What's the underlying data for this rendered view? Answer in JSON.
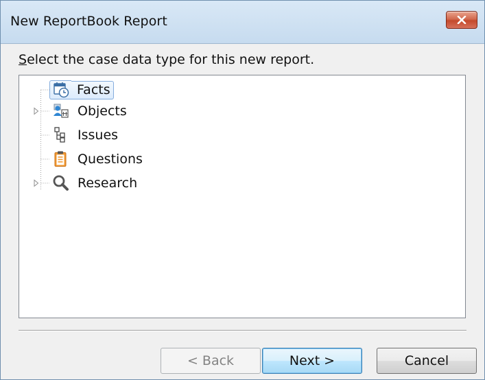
{
  "window": {
    "title": "New ReportBook Report",
    "close_icon": "close-x-icon"
  },
  "instruction": {
    "mnemonic": "S",
    "rest": "elect the case data type for this new report."
  },
  "tree": {
    "items": [
      {
        "label": "Facts",
        "icon": "calendar-clock-icon",
        "expandable": false,
        "selected": true
      },
      {
        "label": "Objects",
        "icon": "people-building-icon",
        "expandable": true,
        "selected": false
      },
      {
        "label": "Issues",
        "icon": "hierarchy-icon",
        "expandable": false,
        "selected": false
      },
      {
        "label": "Questions",
        "icon": "clipboard-icon",
        "expandable": false,
        "selected": false
      },
      {
        "label": "Research",
        "icon": "magnifier-icon",
        "expandable": true,
        "selected": false
      }
    ]
  },
  "buttons": {
    "back": {
      "label": "< Back",
      "enabled": false
    },
    "next": {
      "label": "Next >",
      "enabled": true,
      "default": true
    },
    "cancel": {
      "label": "Cancel",
      "enabled": true
    }
  },
  "colors": {
    "titlebar": "#c6dbef",
    "close_button": "#c44a2c",
    "selection_border": "#84acdd",
    "dialog_background": "#f0f0f0"
  }
}
